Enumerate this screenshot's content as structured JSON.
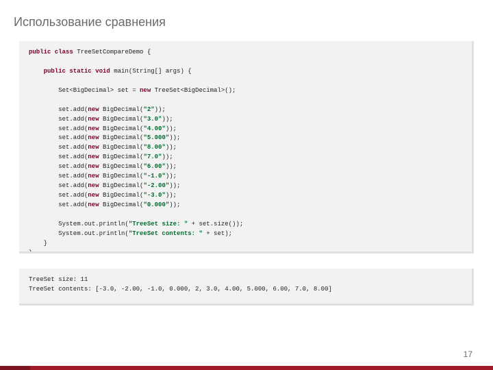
{
  "title": "Использование сравнения",
  "page_number": "17",
  "code": {
    "l01a": "public class",
    "l01b": " TreeSetCompareDemo {",
    "l02a": "    public static void",
    "l02b": " main(String[] args) {",
    "l03a": "        Set<BigDecimal> set = ",
    "l03b": "new",
    "l03c": " TreeSet<BigDecimal>();",
    "l04a": "        set.add(",
    "l04b": "new",
    "l04c": " BigDecimal(",
    "l04d": "\"2\"",
    "l04e": "));",
    "l05a": "        set.add(",
    "l05b": "new",
    "l05c": " BigDecimal(",
    "l05d": "\"3.0\"",
    "l05e": "));",
    "l06a": "        set.add(",
    "l06b": "new",
    "l06c": " BigDecimal(",
    "l06d": "\"4.00\"",
    "l06e": "));",
    "l07a": "        set.add(",
    "l07b": "new",
    "l07c": " BigDecimal(",
    "l07d": "\"5.000\"",
    "l07e": "));",
    "l08a": "        set.add(",
    "l08b": "new",
    "l08c": " BigDecimal(",
    "l08d": "\"8.00\"",
    "l08e": "));",
    "l09a": "        set.add(",
    "l09b": "new",
    "l09c": " BigDecimal(",
    "l09d": "\"7.0\"",
    "l09e": "));",
    "l10a": "        set.add(",
    "l10b": "new",
    "l10c": " BigDecimal(",
    "l10d": "\"6.00\"",
    "l10e": "));",
    "l11a": "        set.add(",
    "l11b": "new",
    "l11c": " BigDecimal(",
    "l11d": "\"-1.0\"",
    "l11e": "));",
    "l12a": "        set.add(",
    "l12b": "new",
    "l12c": " BigDecimal(",
    "l12d": "\"-2.00\"",
    "l12e": "));",
    "l13a": "        set.add(",
    "l13b": "new",
    "l13c": " BigDecimal(",
    "l13d": "\"-3.0\"",
    "l13e": "));",
    "l14a": "        set.add(",
    "l14b": "new",
    "l14c": " BigDecimal(",
    "l14d": "\"0.000\"",
    "l14e": "));",
    "l15a": "        System.out.println(",
    "l15b": "\"TreeSet size: \"",
    "l15c": " + set.size());",
    "l16a": "        System.out.println(",
    "l16b": "\"TreeSet contents: \"",
    "l16c": " + set);",
    "l17": "    }",
    "l18": "}"
  },
  "output": {
    "line1": "TreeSet size: 11",
    "line2": "TreeSet contents: [-3.0, -2.00, -1.0, 0.000, 2, 3.0, 4.00, 5.000, 6.00, 7.0, 8.00]"
  }
}
